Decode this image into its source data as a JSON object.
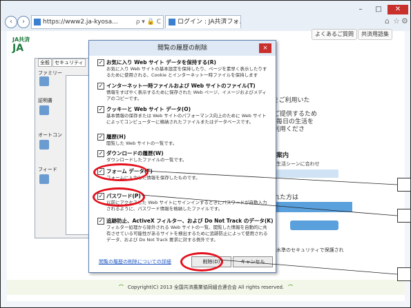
{
  "browser": {
    "address_url": "https://www2.ja-kyosa...",
    "address_controls": "ρ ▾ 🔒 C",
    "tab_title": "ログイン : JA共済フォルダーネット",
    "tab_close": "×",
    "minimize": "–",
    "maximize": "□",
    "close": "✕",
    "back": "‹",
    "forward": "›"
  },
  "site": {
    "logo_small": "JA共済",
    "logo_large": "JA",
    "faq_button": "よくあるご質問",
    "glossary_button": "共済用語集",
    "right_texts": [
      "ネット>をご利用いた",
      "る安心をご提供するため",
      "毎日の生活を",
      "共済をご利用くださ",
      "案内",
      "生活シーンに合わせ",
      "ードを忘れた方は",
      "水準のセキュリティで保護され"
    ],
    "footer": "Copyright(C) 2013 全国共済農業協同組合連合会 All rights reserved."
  },
  "options_dialog": {
    "tabs": [
      "全般",
      "セキュリティ"
    ],
    "labels": [
      "ファミリー",
      "証明書",
      "オートコン",
      "フィード"
    ]
  },
  "dialog": {
    "title": "閲覧の履歴の削除",
    "close_label": "×",
    "items": [
      {
        "checked": true,
        "label": "お気に入り Web サイト データを保持する(R)",
        "desc": "お気に入り Web サイトの基本設定を保持したり、ページを素早く表示したりするために使用される、Cookie とインターネット一時ファイルを保持します"
      },
      {
        "checked": true,
        "label": "インターネット一時ファイルおよび Web サイトのファイル(T)",
        "desc": "情報をすばやく表示するために保存された Web ページ、イメージおよびメディアのコピーです。"
      },
      {
        "checked": true,
        "label": "クッキーと Web サイト データ(O)",
        "desc": "基本情報の保存または Web サイトのパフォーマンス向上のために Web サイトによってコンピューターに格納されたファイルまたはデータベースです。"
      },
      {
        "checked": true,
        "label": "履歴(H)",
        "desc": "閲覧した Web サイトの一覧です。"
      },
      {
        "checked": true,
        "label": "ダウンロードの履歴(W)",
        "desc": "ダウンロードしたファイルの一覧です。"
      },
      {
        "checked": true,
        "label": "フォーム データ(F)",
        "desc": "フォームに入力した情報を保存したものです。"
      },
      {
        "checked": true,
        "label": "パスワード(P)",
        "desc": "以前にアクセスした Web サイトにサインインするときにパスワードが自動入力されるように、パスワード情報を格納したファイルです。"
      },
      {
        "checked": true,
        "label": "追跡防止、ActiveX フィルター、および Do Not Track のデータ(K)",
        "desc": "フィルター処理から除外される Web サイトの一覧、閲覧した情報を自動的に共有させている可能性があるサイトを検出するために追跡防止によって使用されるデータ、および Do Not Track 要求に対する例外です。"
      }
    ],
    "help_link": "閲覧の履歴の削除についての詳細",
    "delete_button": "削除(D)",
    "cancel_button": "キャンセル"
  },
  "colors": {
    "annotation_ring": "#e3101c",
    "titlebar": "#dfe9f5",
    "accent": "#1f57c3"
  }
}
